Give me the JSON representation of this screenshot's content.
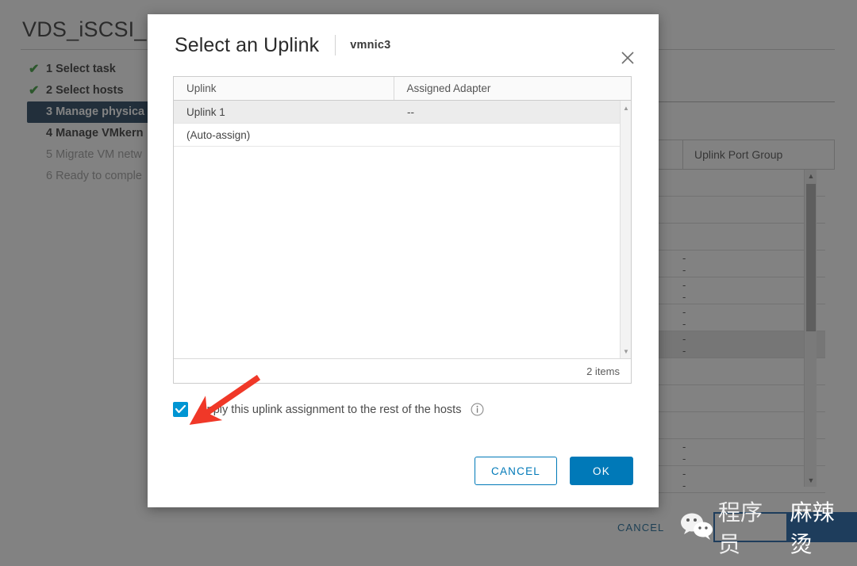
{
  "background": {
    "page_title": "VDS_iSCSI_S",
    "steps": [
      {
        "label": "1 Select task",
        "state": "done"
      },
      {
        "label": "2 Select hosts",
        "state": "done"
      },
      {
        "label": "3 Manage physica",
        "state": "active"
      },
      {
        "label": "4 Manage VMkern",
        "state": "current"
      },
      {
        "label": "5 Migrate VM netw",
        "state": "muted"
      },
      {
        "label": "6 Ready to comple",
        "state": "muted"
      }
    ],
    "table": {
      "headers": [
        "",
        "Uplink Port Group"
      ],
      "rows": [
        {
          "value": "",
          "selected": false
        },
        {
          "value": "",
          "selected": false
        },
        {
          "value": "",
          "selected": false
        },
        {
          "value": "--",
          "selected": false
        },
        {
          "value": "--",
          "selected": false
        },
        {
          "value": "--",
          "selected": false
        },
        {
          "value": "--",
          "selected": true
        },
        {
          "value": "",
          "selected": false
        },
        {
          "value": "",
          "selected": false
        },
        {
          "value": "",
          "selected": false
        },
        {
          "value": "--",
          "selected": false
        },
        {
          "value": "--",
          "selected": false
        }
      ]
    },
    "cancel_label": "CANCEL"
  },
  "modal": {
    "title": "Select an Uplink",
    "subtitle": "vmnic3",
    "close_icon": "close-icon",
    "table": {
      "headers": [
        "Uplink",
        "Assigned Adapter"
      ],
      "rows": [
        {
          "uplink": "Uplink 1",
          "adapter": "--",
          "selected": true
        },
        {
          "uplink": "(Auto-assign)",
          "adapter": "",
          "selected": false
        }
      ],
      "footer_count": "2 items"
    },
    "apply_checkbox": {
      "checked": true,
      "label": "Apply this uplink assignment to the rest of the hosts",
      "info_icon": "info-icon"
    },
    "buttons": {
      "cancel": "CANCEL",
      "ok": "OK"
    }
  },
  "annotation": {
    "arrow_color": "#f03828",
    "arrow_target": "apply-uplink-checkbox"
  },
  "watermark": {
    "text_boxed": "程序员",
    "text_filled": "麻辣烫",
    "logo": "wechat-logo"
  },
  "colors": {
    "primary_blue": "#0079b8",
    "checkbox_blue": "#0095d3",
    "active_step_bg": "#1b3a57",
    "check_green": "#339933",
    "annotation_red": "#f03828",
    "watermark_navy": "#1e3d5c"
  }
}
